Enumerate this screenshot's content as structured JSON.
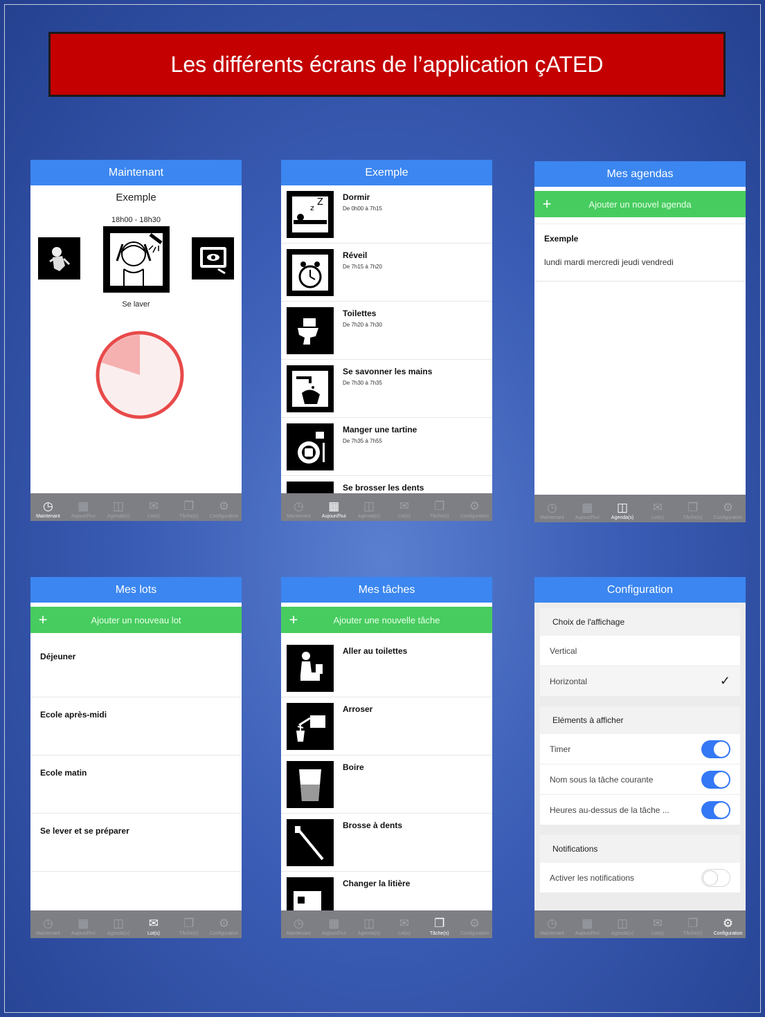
{
  "banner": {
    "title": "Les différents écrans de l’application çATED"
  },
  "tab_labels": [
    "Maintenant",
    "Aujourd'hui",
    "Agenda(s)",
    "Lot(s)",
    "Tâche(s)",
    "Configuration"
  ],
  "tab_icons": [
    "clock-icon",
    "calendar-icon",
    "agenda-icon",
    "lot-icon",
    "tasks-icon",
    "gear-icon"
  ],
  "screen1": {
    "header": "Maintenant",
    "agenda_name": "Exemple",
    "time_range": "18h00 - 18h30",
    "current_task": "Se laver",
    "timer_elapsed_fraction": 0.2,
    "active_tab": 0
  },
  "screen2": {
    "header": "Exemple",
    "items": [
      {
        "title": "Dormir",
        "sub": "De 0h00 à 7h15"
      },
      {
        "title": "Réveil",
        "sub": "De 7h15 à 7h20"
      },
      {
        "title": "Toilettes",
        "sub": "De 7h20 à 7h30"
      },
      {
        "title": "Se savonner les mains",
        "sub": "De 7h30 à 7h35"
      },
      {
        "title": "Manger une tartine",
        "sub": "De 7h35 à 7h55"
      },
      {
        "title": "Se brosser les dents",
        "sub": ""
      }
    ],
    "active_tab": 1
  },
  "screen3": {
    "header": "Mes agendas",
    "add_label": "Ajouter un nouvel agenda",
    "agenda_title": "Exemple",
    "agenda_days": "lundi mardi mercredi jeudi vendredi",
    "active_tab": 2
  },
  "screen4": {
    "header": "Mes lots",
    "add_label": "Ajouter un nouveau lot",
    "lots": [
      "Déjeuner",
      "Ecole après-midi",
      "Ecole matin",
      "Se lever et se préparer"
    ],
    "active_tab": 3
  },
  "screen5": {
    "header": "Mes tâches",
    "add_label": "Ajouter une nouvelle tâche",
    "tasks": [
      "Aller au toilettes",
      "Arroser",
      "Boire",
      "Brosse à dents",
      "Changer la litière"
    ],
    "active_tab": 4
  },
  "screen6": {
    "header": "Configuration",
    "section_display": "Choix de l'affichage",
    "opt_vertical": "Vertical",
    "opt_horizontal": "Horizontal",
    "section_elements": "Eléments à afficher",
    "el_timer": "Timer",
    "el_name": "Nom sous la tâche courante",
    "el_hours": "Heures au-dessus de la tâche ...",
    "section_notifications": "Notifications",
    "notif_activate": "Activer les notifications",
    "toggles": {
      "timer": true,
      "name": true,
      "hours": true,
      "notifications": false
    },
    "active_tab": 5
  },
  "colors": {
    "header": "#3b86f0",
    "add_bar": "#47cc5f",
    "banner": "#c40000",
    "timer": "#e84a4a"
  }
}
